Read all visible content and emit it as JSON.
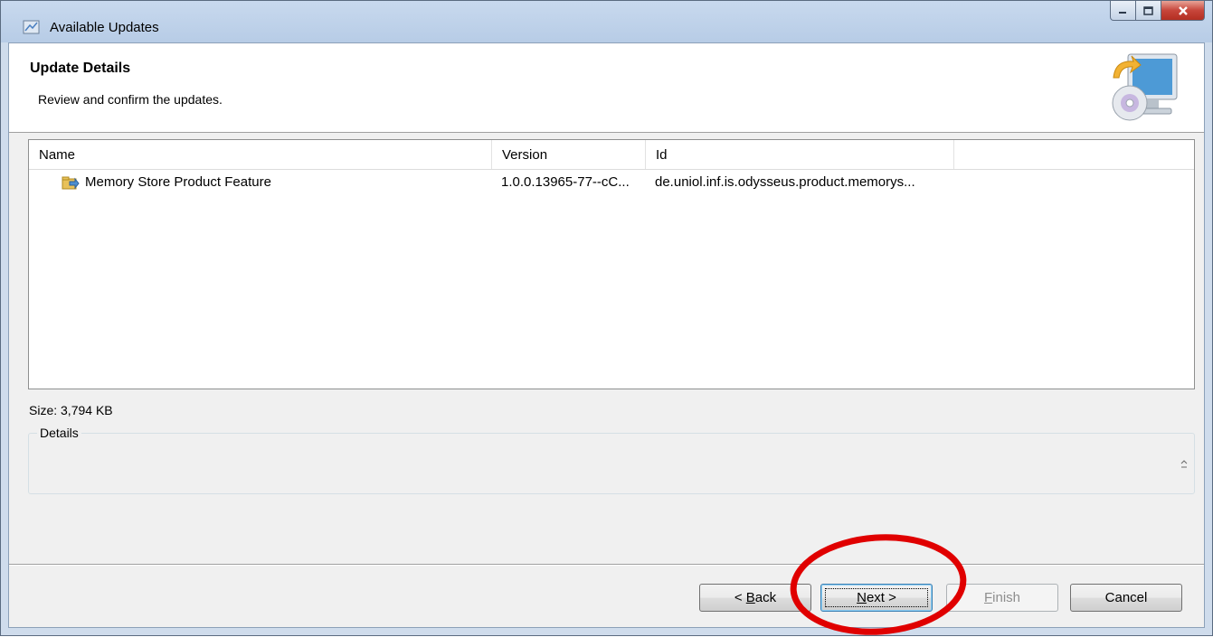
{
  "window": {
    "title": "Available Updates",
    "accent_color": "#b7cce6",
    "close_color": "#c7453a"
  },
  "banner": {
    "title": "Update Details",
    "description": "Review and confirm the updates.",
    "graphic_icon": "computer-update-icon"
  },
  "table": {
    "columns": [
      "Name",
      "Version",
      "Id"
    ],
    "rows": [
      {
        "icon": "feature-update-icon",
        "name": "Memory Store Product Feature",
        "version": "1.0.0.13965-77--cC...",
        "id": "de.uniol.inf.is.odysseus.product.memorys..."
      }
    ]
  },
  "size_label": "Size: 3,794 KB",
  "details": {
    "legend": "Details"
  },
  "buttons": {
    "back": {
      "prefix": "< ",
      "mnemonic": "B",
      "rest": "ack"
    },
    "next": {
      "mnemonic": "N",
      "rest": "ext >"
    },
    "finish": {
      "mnemonic": "F",
      "rest": "inish"
    },
    "cancel": "Cancel"
  },
  "annotation": {
    "color": "#e00000",
    "shape": "ellipse"
  }
}
